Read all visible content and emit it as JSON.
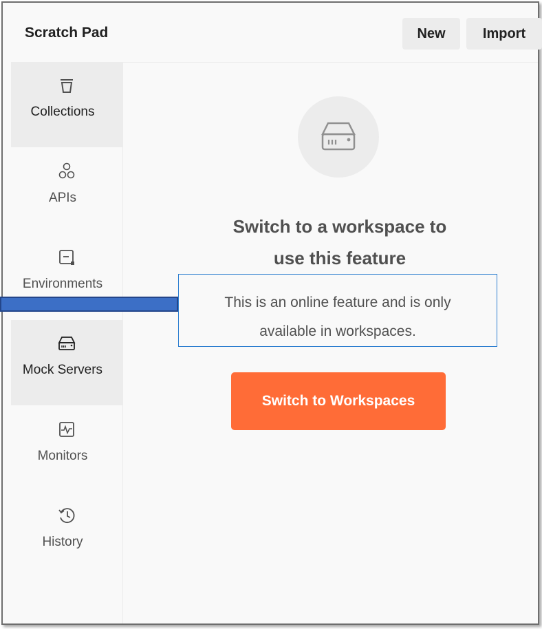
{
  "header": {
    "title": "Scratch Pad",
    "new_label": "New",
    "import_label": "Import"
  },
  "sidebar": {
    "items": [
      {
        "label": "Collections",
        "icon": "trash-bin-icon",
        "active": true
      },
      {
        "label": "APIs",
        "icon": "apis-icon",
        "active": false
      },
      {
        "label": "Environments",
        "icon": "environments-icon",
        "active": false
      },
      {
        "label": "Mock Servers",
        "icon": "server-icon",
        "active": true
      },
      {
        "label": "Monitors",
        "icon": "monitor-icon",
        "active": false
      },
      {
        "label": "History",
        "icon": "history-icon",
        "active": false
      }
    ]
  },
  "main": {
    "icon": "server-icon",
    "heading_line1": "Switch to a workspace to",
    "heading_line2": "use this feature",
    "desc_line1": "This is an online feature and is only",
    "desc_line2": "available in workspaces.",
    "cta_label": "Switch to Workspaces"
  },
  "colors": {
    "accent": "#ff6c37",
    "highlight_box": "#2e7fd0",
    "annotation_arrow": "#3c6fc6"
  }
}
